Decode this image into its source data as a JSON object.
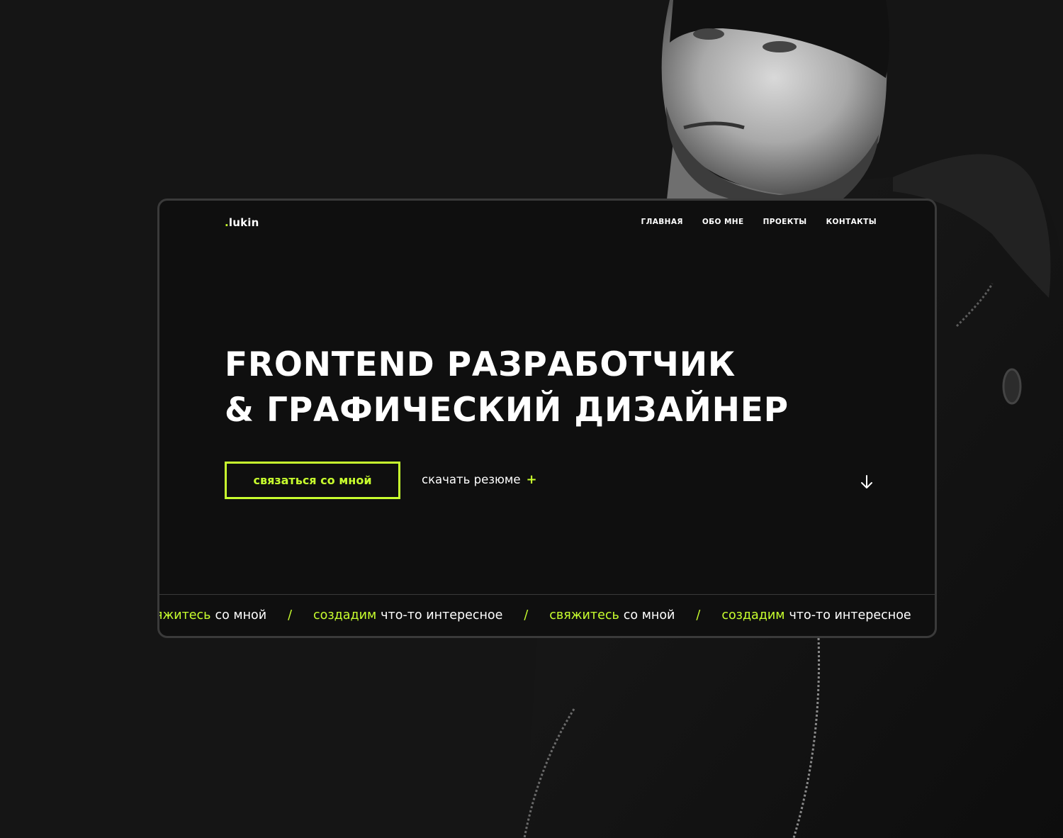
{
  "colors": {
    "accent": "#c8ff2e",
    "background": "#151515",
    "card": "#0f0f0f",
    "text": "#ffffff"
  },
  "logo": {
    "dot": ".",
    "name": "lukin"
  },
  "nav": {
    "items": [
      {
        "label": "ГЛАВНАЯ"
      },
      {
        "label": "ОБО МНЕ"
      },
      {
        "label": "ПРОЕКТЫ"
      },
      {
        "label": "КОНТАКТЫ"
      }
    ]
  },
  "hero": {
    "title_line1": "FRONTEND РАЗРАБОТЧИК",
    "title_line2": "& ГРАФИЧЕСКИЙ ДИЗАЙНЕР",
    "cta_label": "связаться со мной",
    "resume_label": "скачать резюме",
    "resume_icon": "plus-icon",
    "scroll_icon": "arrow-down-icon"
  },
  "ticker": {
    "items": [
      {
        "accent": "свяжитесь",
        "rest": "со мной"
      },
      {
        "accent": "создадим",
        "rest": "что-то интересное"
      },
      {
        "accent": "свяжитесь",
        "rest": "со мной"
      },
      {
        "accent": "создадим",
        "rest": "что-то интересное"
      }
    ],
    "separator": "/"
  }
}
